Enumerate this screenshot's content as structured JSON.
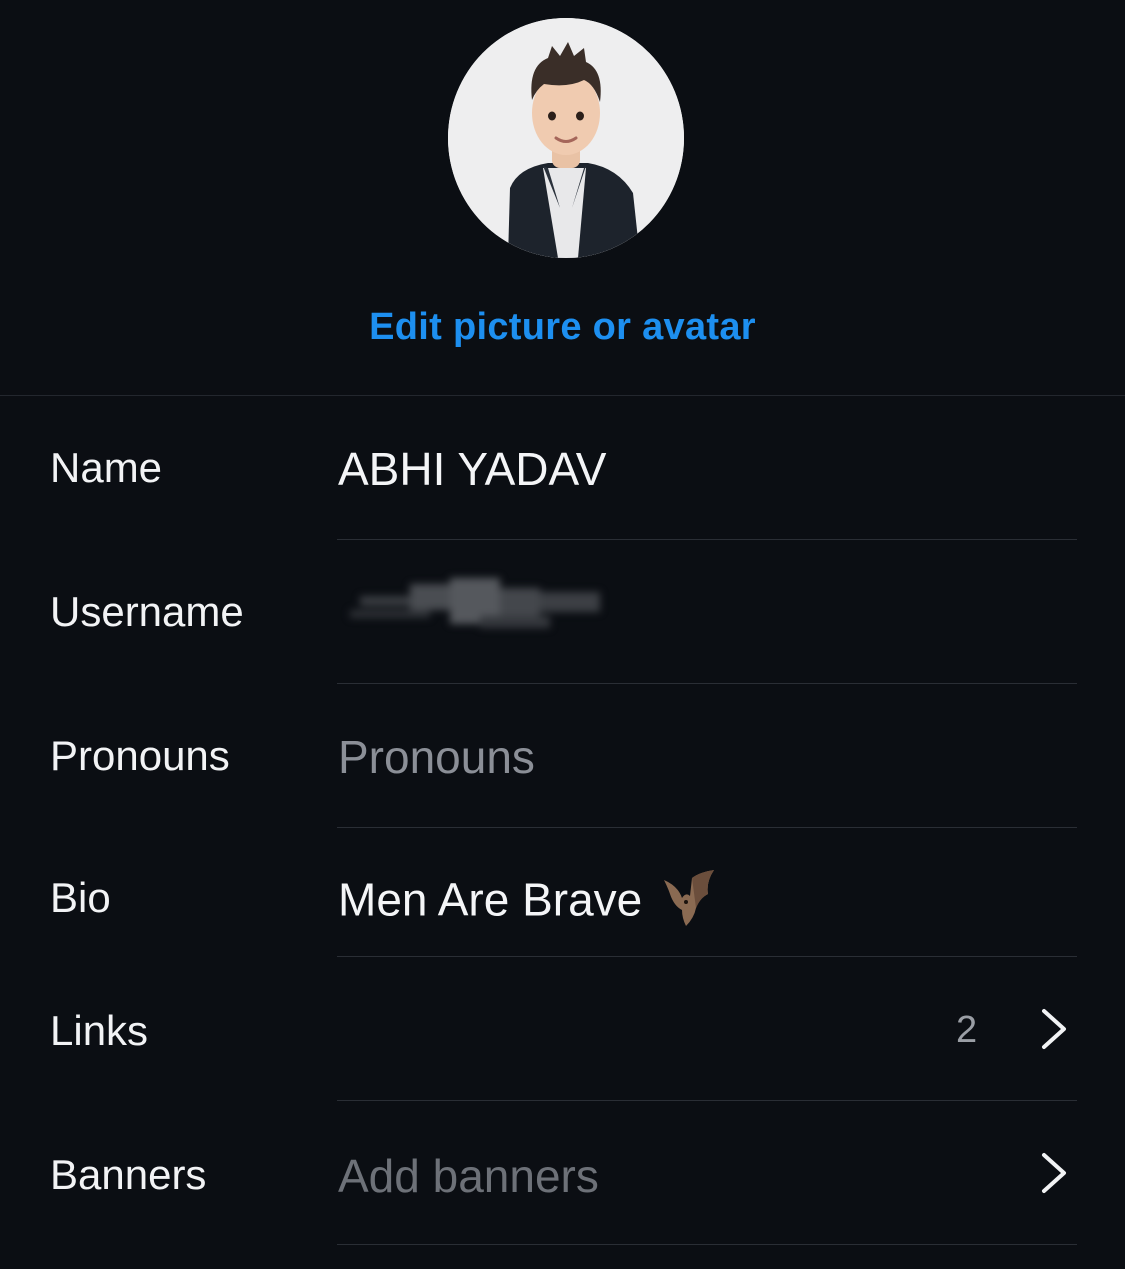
{
  "profile": {
    "edit_avatar_label": "Edit picture or avatar"
  },
  "fields": {
    "name": {
      "label": "Name",
      "value": "ABHI YADAV"
    },
    "username": {
      "label": "Username",
      "value_obscured": true
    },
    "pronouns": {
      "label": "Pronouns",
      "placeholder": "Pronouns"
    },
    "bio": {
      "label": "Bio",
      "value": "Men Are Brave",
      "emoji_icon": "bat-icon"
    },
    "links": {
      "label": "Links",
      "count": "2"
    },
    "banners": {
      "label": "Banners",
      "placeholder": "Add banners"
    }
  },
  "colors": {
    "background": "#0b0e13",
    "accent": "#1d8ff0",
    "divider": "#2a2e35",
    "placeholder": "#8b8f97"
  }
}
